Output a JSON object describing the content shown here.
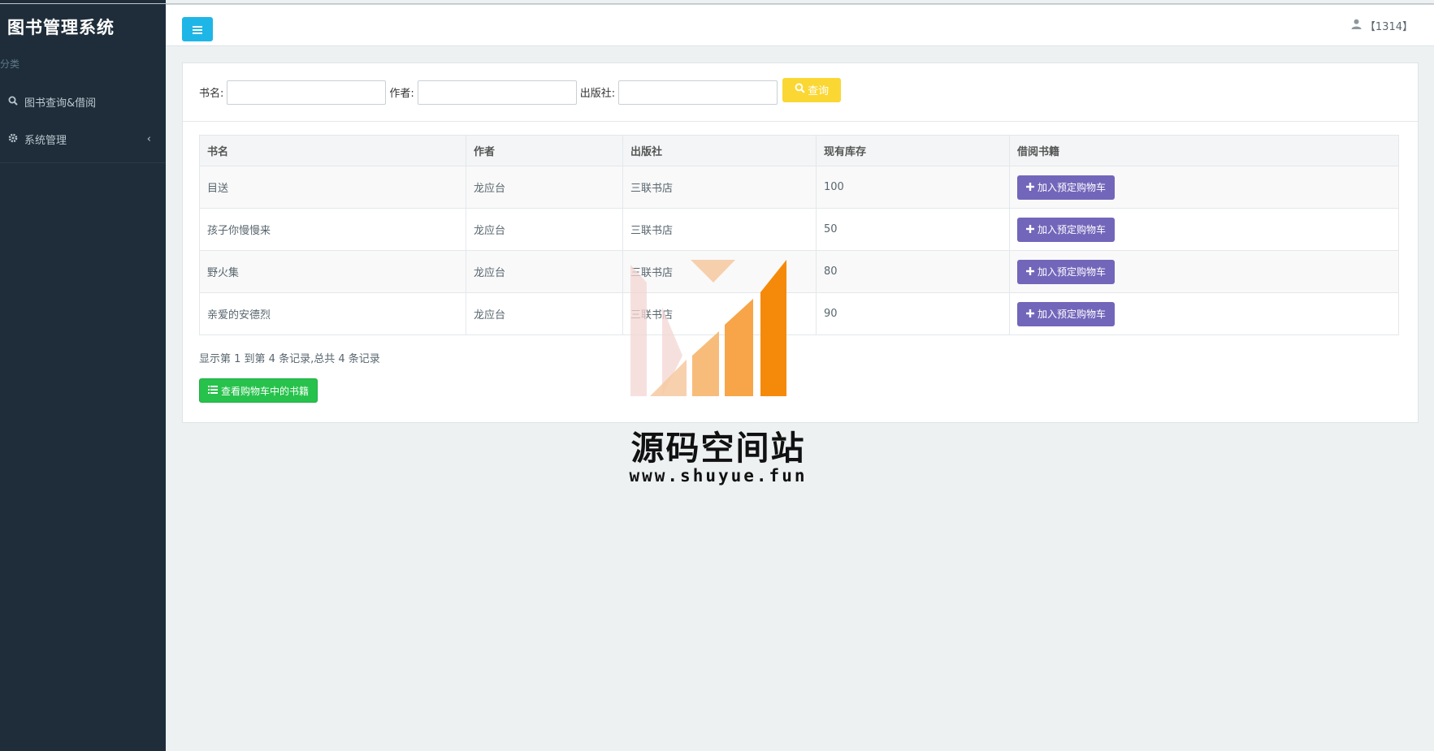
{
  "app": {
    "title": "图书管理系统"
  },
  "sidebar": {
    "header": "分类",
    "items": [
      {
        "label": "图书查询&借阅",
        "icon": "search-icon"
      },
      {
        "label": "系统管理",
        "icon": "gear-icon",
        "caret": "‹"
      }
    ]
  },
  "topbar": {
    "user_label": "【1314】"
  },
  "search": {
    "book_label": "书名:",
    "author_label": "作者:",
    "publisher_label": "出版社:",
    "book_value": "",
    "author_value": "",
    "publisher_value": "",
    "button_label": "查询"
  },
  "table": {
    "columns": [
      "书名",
      "作者",
      "出版社",
      "现有库存",
      "借阅书籍"
    ],
    "rows": [
      {
        "title": "目送",
        "author": "龙应台",
        "publisher": "三联书店",
        "stock": "100",
        "action": "加入预定购物车"
      },
      {
        "title": "孩子你慢慢来",
        "author": "龙应台",
        "publisher": "三联书店",
        "stock": "50",
        "action": "加入预定购物车"
      },
      {
        "title": "野火集",
        "author": "龙应台",
        "publisher": "三联书店",
        "stock": "80",
        "action": "加入预定购物车"
      },
      {
        "title": "亲爱的安德烈",
        "author": "龙应台",
        "publisher": "三联书店",
        "stock": "90",
        "action": "加入预定购物车"
      }
    ]
  },
  "summary": "显示第 1 到第 4 条记录,总共 4 条记录",
  "cart_button_label": "查看购物车中的书籍",
  "watermark": {
    "title": "源码空间站",
    "url": "www.shuyue.fun"
  },
  "colors": {
    "sidebar_bg": "#1f2d3a",
    "toggle_btn": "#1eb6e6",
    "search_btn": "#fad733",
    "add_btn": "#7266ba",
    "cart_btn": "#27c24c"
  }
}
